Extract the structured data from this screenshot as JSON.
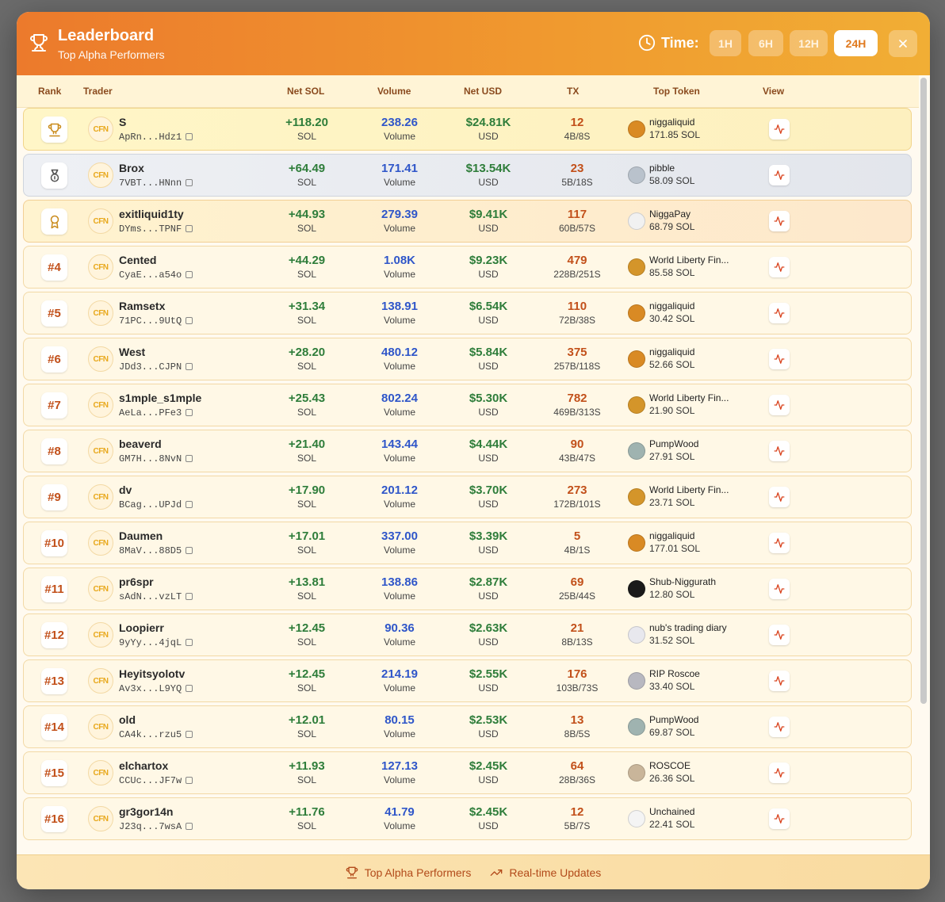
{
  "header": {
    "title": "Leaderboard",
    "subtitle": "Top Alpha Performers",
    "time_label": "Time:",
    "time_options": [
      "1H",
      "6H",
      "12H",
      "24H"
    ],
    "active_time": "24H"
  },
  "columns": {
    "rank": "Rank",
    "trader": "Trader",
    "net_sol": "Net SOL",
    "volume": "Volume",
    "net_usd": "Net USD",
    "tx": "TX",
    "top_token": "Top Token",
    "view": "View"
  },
  "units": {
    "sol": "SOL",
    "volume": "Volume",
    "usd": "USD"
  },
  "rows": [
    {
      "rank": "trophy",
      "name": "S",
      "addr": "ApRn...Hdz1",
      "net_sol": "+118.20",
      "volume": "238.26",
      "net_usd": "$24.81K",
      "tx": "12",
      "tx_split": "4B/8S",
      "token": "niggaliquid",
      "token_sol": "171.85 SOL",
      "token_color": "#d98a24"
    },
    {
      "rank": "medal",
      "name": "Brox",
      "addr": "7VBT...HNnn",
      "net_sol": "+64.49",
      "volume": "171.41",
      "net_usd": "$13.54K",
      "tx": "23",
      "tx_split": "5B/18S",
      "token": "pibble",
      "token_sol": "58.09 SOL",
      "token_color": "#b9c2cc"
    },
    {
      "rank": "award",
      "name": "exitliquid1ty",
      "addr": "DYms...TPNF",
      "net_sol": "+44.93",
      "volume": "279.39",
      "net_usd": "$9.41K",
      "tx": "117",
      "tx_split": "60B/57S",
      "token": "NiggaPay",
      "token_sol": "68.79 SOL",
      "token_color": "#f1f1f1"
    },
    {
      "rank": "#4",
      "name": "Cented",
      "addr": "CyaE...a54o",
      "net_sol": "+44.29",
      "volume": "1.08K",
      "net_usd": "$9.23K",
      "tx": "479",
      "tx_split": "228B/251S",
      "token": "World Liberty Fin...",
      "token_sol": "85.58 SOL",
      "token_color": "#d4952a"
    },
    {
      "rank": "#5",
      "name": "Ramsetx",
      "addr": "71PC...9UtQ",
      "net_sol": "+31.34",
      "volume": "138.91",
      "net_usd": "$6.54K",
      "tx": "110",
      "tx_split": "72B/38S",
      "token": "niggaliquid",
      "token_sol": "30.42 SOL",
      "token_color": "#d98a24"
    },
    {
      "rank": "#6",
      "name": "West",
      "addr": "JDd3...CJPN",
      "net_sol": "+28.20",
      "volume": "480.12",
      "net_usd": "$5.84K",
      "tx": "375",
      "tx_split": "257B/118S",
      "token": "niggaliquid",
      "token_sol": "52.66 SOL",
      "token_color": "#d98a24"
    },
    {
      "rank": "#7",
      "name": "s1mple_s1mple",
      "addr": "AeLa...PFe3",
      "net_sol": "+25.43",
      "volume": "802.24",
      "net_usd": "$5.30K",
      "tx": "782",
      "tx_split": "469B/313S",
      "token": "World Liberty Fin...",
      "token_sol": "21.90 SOL",
      "token_color": "#d4952a"
    },
    {
      "rank": "#8",
      "name": "beaverd",
      "addr": "GM7H...8NvN",
      "net_sol": "+21.40",
      "volume": "143.44",
      "net_usd": "$4.44K",
      "tx": "90",
      "tx_split": "43B/47S",
      "token": "PumpWood",
      "token_sol": "27.91 SOL",
      "token_color": "#9fb3b0"
    },
    {
      "rank": "#9",
      "name": "dv",
      "addr": "BCag...UPJd",
      "net_sol": "+17.90",
      "volume": "201.12",
      "net_usd": "$3.70K",
      "tx": "273",
      "tx_split": "172B/101S",
      "token": "World Liberty Fin...",
      "token_sol": "23.71 SOL",
      "token_color": "#d4952a"
    },
    {
      "rank": "#10",
      "name": "Daumen",
      "addr": "8MaV...88D5",
      "net_sol": "+17.01",
      "volume": "337.00",
      "net_usd": "$3.39K",
      "tx": "5",
      "tx_split": "4B/1S",
      "token": "niggaliquid",
      "token_sol": "177.01 SOL",
      "token_color": "#d98a24"
    },
    {
      "rank": "#11",
      "name": "pr6spr",
      "addr": "sAdN...vzLT",
      "net_sol": "+13.81",
      "volume": "138.86",
      "net_usd": "$2.87K",
      "tx": "69",
      "tx_split": "25B/44S",
      "token": "Shub-Niggurath",
      "token_sol": "12.80 SOL",
      "token_color": "#1a1a1a"
    },
    {
      "rank": "#12",
      "name": "Loopierr",
      "addr": "9yYy...4jqL",
      "net_sol": "+12.45",
      "volume": "90.36",
      "net_usd": "$2.63K",
      "tx": "21",
      "tx_split": "8B/13S",
      "token": "nub's trading diary",
      "token_sol": "31.52 SOL",
      "token_color": "#e8e8ee"
    },
    {
      "rank": "#13",
      "name": "Heyitsyolotv",
      "addr": "Av3x...L9YQ",
      "net_sol": "+12.45",
      "volume": "214.19",
      "net_usd": "$2.55K",
      "tx": "176",
      "tx_split": "103B/73S",
      "token": "RIP Roscoe",
      "token_sol": "33.40 SOL",
      "token_color": "#b8b8c0"
    },
    {
      "rank": "#14",
      "name": "old",
      "addr": "CA4k...rzu5",
      "net_sol": "+12.01",
      "volume": "80.15",
      "net_usd": "$2.53K",
      "tx": "13",
      "tx_split": "8B/5S",
      "token": "PumpWood",
      "token_sol": "69.87 SOL",
      "token_color": "#9fb3b0"
    },
    {
      "rank": "#15",
      "name": "elchartox",
      "addr": "CCUc...JF7w",
      "net_sol": "+11.93",
      "volume": "127.13",
      "net_usd": "$2.45K",
      "tx": "64",
      "tx_split": "28B/36S",
      "token": "ROSCOE",
      "token_sol": "26.36 SOL",
      "token_color": "#c9b59a"
    },
    {
      "rank": "#16",
      "name": "gr3gor14n",
      "addr": "J23q...7wsA",
      "net_sol": "+11.76",
      "volume": "41.79",
      "net_usd": "$2.45K",
      "tx": "12",
      "tx_split": "5B/7S",
      "token": "Unchained",
      "token_sol": "22.41 SOL",
      "token_color": "#f4f4f4"
    }
  ],
  "footer": {
    "left": "Top Alpha Performers",
    "right": "Real-time Updates"
  }
}
